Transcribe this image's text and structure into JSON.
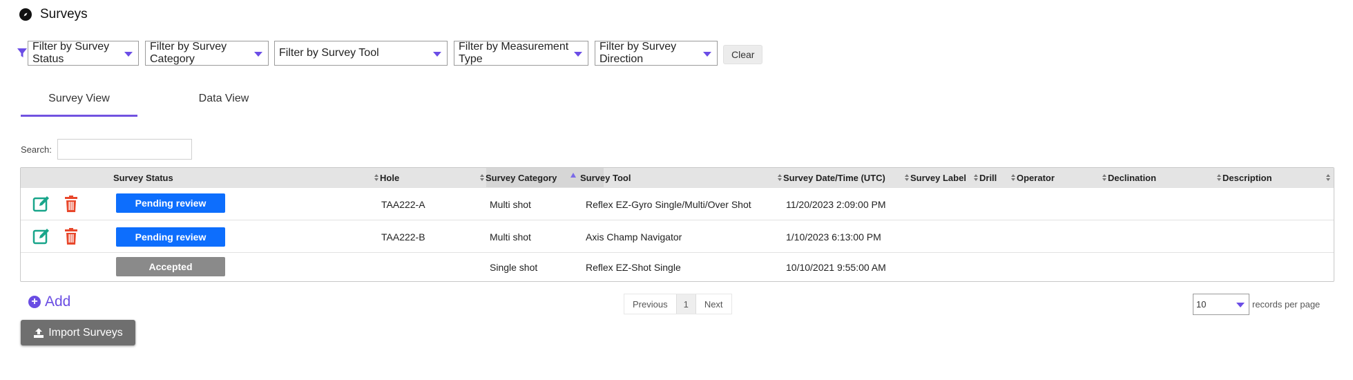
{
  "page": {
    "title": "Surveys"
  },
  "filters": {
    "status": "Filter by Survey Status",
    "category": "Filter by Survey Category",
    "tool": "Filter by Survey Tool",
    "measurement": "Filter by Measurement Type",
    "direction": "Filter by Survey Direction",
    "clear_label": "Clear"
  },
  "tabs": {
    "survey_view": "Survey View",
    "data_view": "Data View"
  },
  "search": {
    "label": "Search:",
    "value": ""
  },
  "table": {
    "headers": {
      "status": "Survey Status",
      "hole": "Hole",
      "category": "Survey Category",
      "tool": "Survey Tool",
      "datetime": "Survey Date/Time (UTC)",
      "label": "Survey Label",
      "drill": "Drill",
      "operator": "Operator",
      "declination": "Declination",
      "description": "Description"
    },
    "rows": [
      {
        "status": "Pending review",
        "hole": "TAA222-A",
        "category": "Multi shot",
        "tool": "Reflex EZ-Gyro Single/Multi/Over Shot",
        "datetime": "11/20/2023 2:09:00 PM"
      },
      {
        "status": "Pending review",
        "hole": "TAA222-B",
        "category": "Multi shot",
        "tool": "Axis Champ Navigator",
        "datetime": "1/10/2023 6:13:00 PM"
      },
      {
        "status": "Accepted",
        "hole": "",
        "category": "Single shot",
        "tool": "Reflex EZ-Shot Single",
        "datetime": "10/10/2021 9:55:00 AM"
      }
    ]
  },
  "actions": {
    "add_label": "Add",
    "import_label": "Import Surveys"
  },
  "pagination": {
    "previous": "Previous",
    "page": "1",
    "next": "Next"
  },
  "per_page": {
    "value": "10",
    "label": "records per page"
  },
  "colors": {
    "accent": "#6a4de3",
    "pending": "#0d6efd",
    "accepted": "#8a8a8a",
    "edit": "#18a58a",
    "delete": "#e8472b"
  }
}
